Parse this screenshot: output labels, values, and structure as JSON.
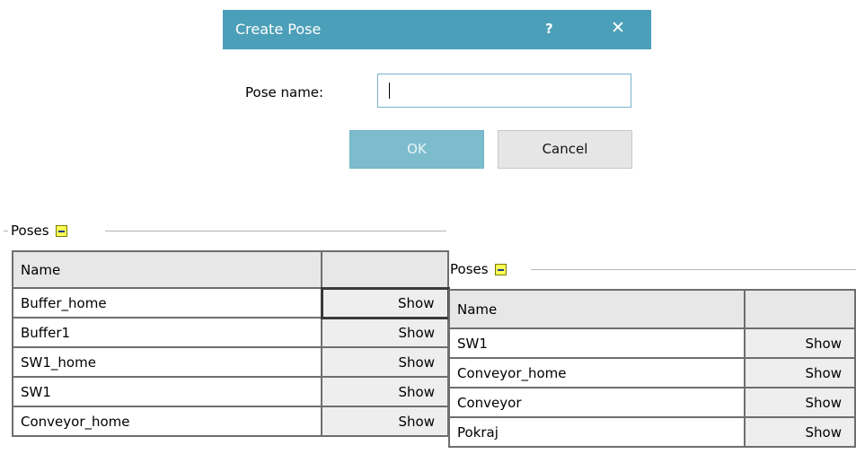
{
  "dialog": {
    "title": "Create Pose",
    "help_symbol": "?",
    "close_symbol": "✕",
    "pose_name_label": "Pose name:",
    "pose_name_value": "",
    "ok_label": "OK",
    "cancel_label": "Cancel"
  },
  "left_panel": {
    "group_label": "Poses",
    "header": {
      "name": "Name",
      "action": ""
    },
    "rows": [
      {
        "name": "Buffer_home",
        "action": "Show"
      },
      {
        "name": "Buffer1",
        "action": "Show"
      },
      {
        "name": "SW1_home",
        "action": "Show"
      },
      {
        "name": "SW1",
        "action": "Show"
      },
      {
        "name": "Conveyor_home",
        "action": "Show"
      }
    ]
  },
  "right_panel": {
    "group_label": "Poses",
    "header": {
      "name": "Name",
      "action": ""
    },
    "rows": [
      {
        "name": "SW1",
        "action": "Show"
      },
      {
        "name": "Conveyor_home",
        "action": "Show"
      },
      {
        "name": "Conveyor",
        "action": "Show"
      },
      {
        "name": "Pokraj",
        "action": "Show"
      }
    ]
  },
  "colors": {
    "titlebar": "#4c9fb8",
    "ok_button": "#7cbccd",
    "input_border": "#78b4cc"
  }
}
